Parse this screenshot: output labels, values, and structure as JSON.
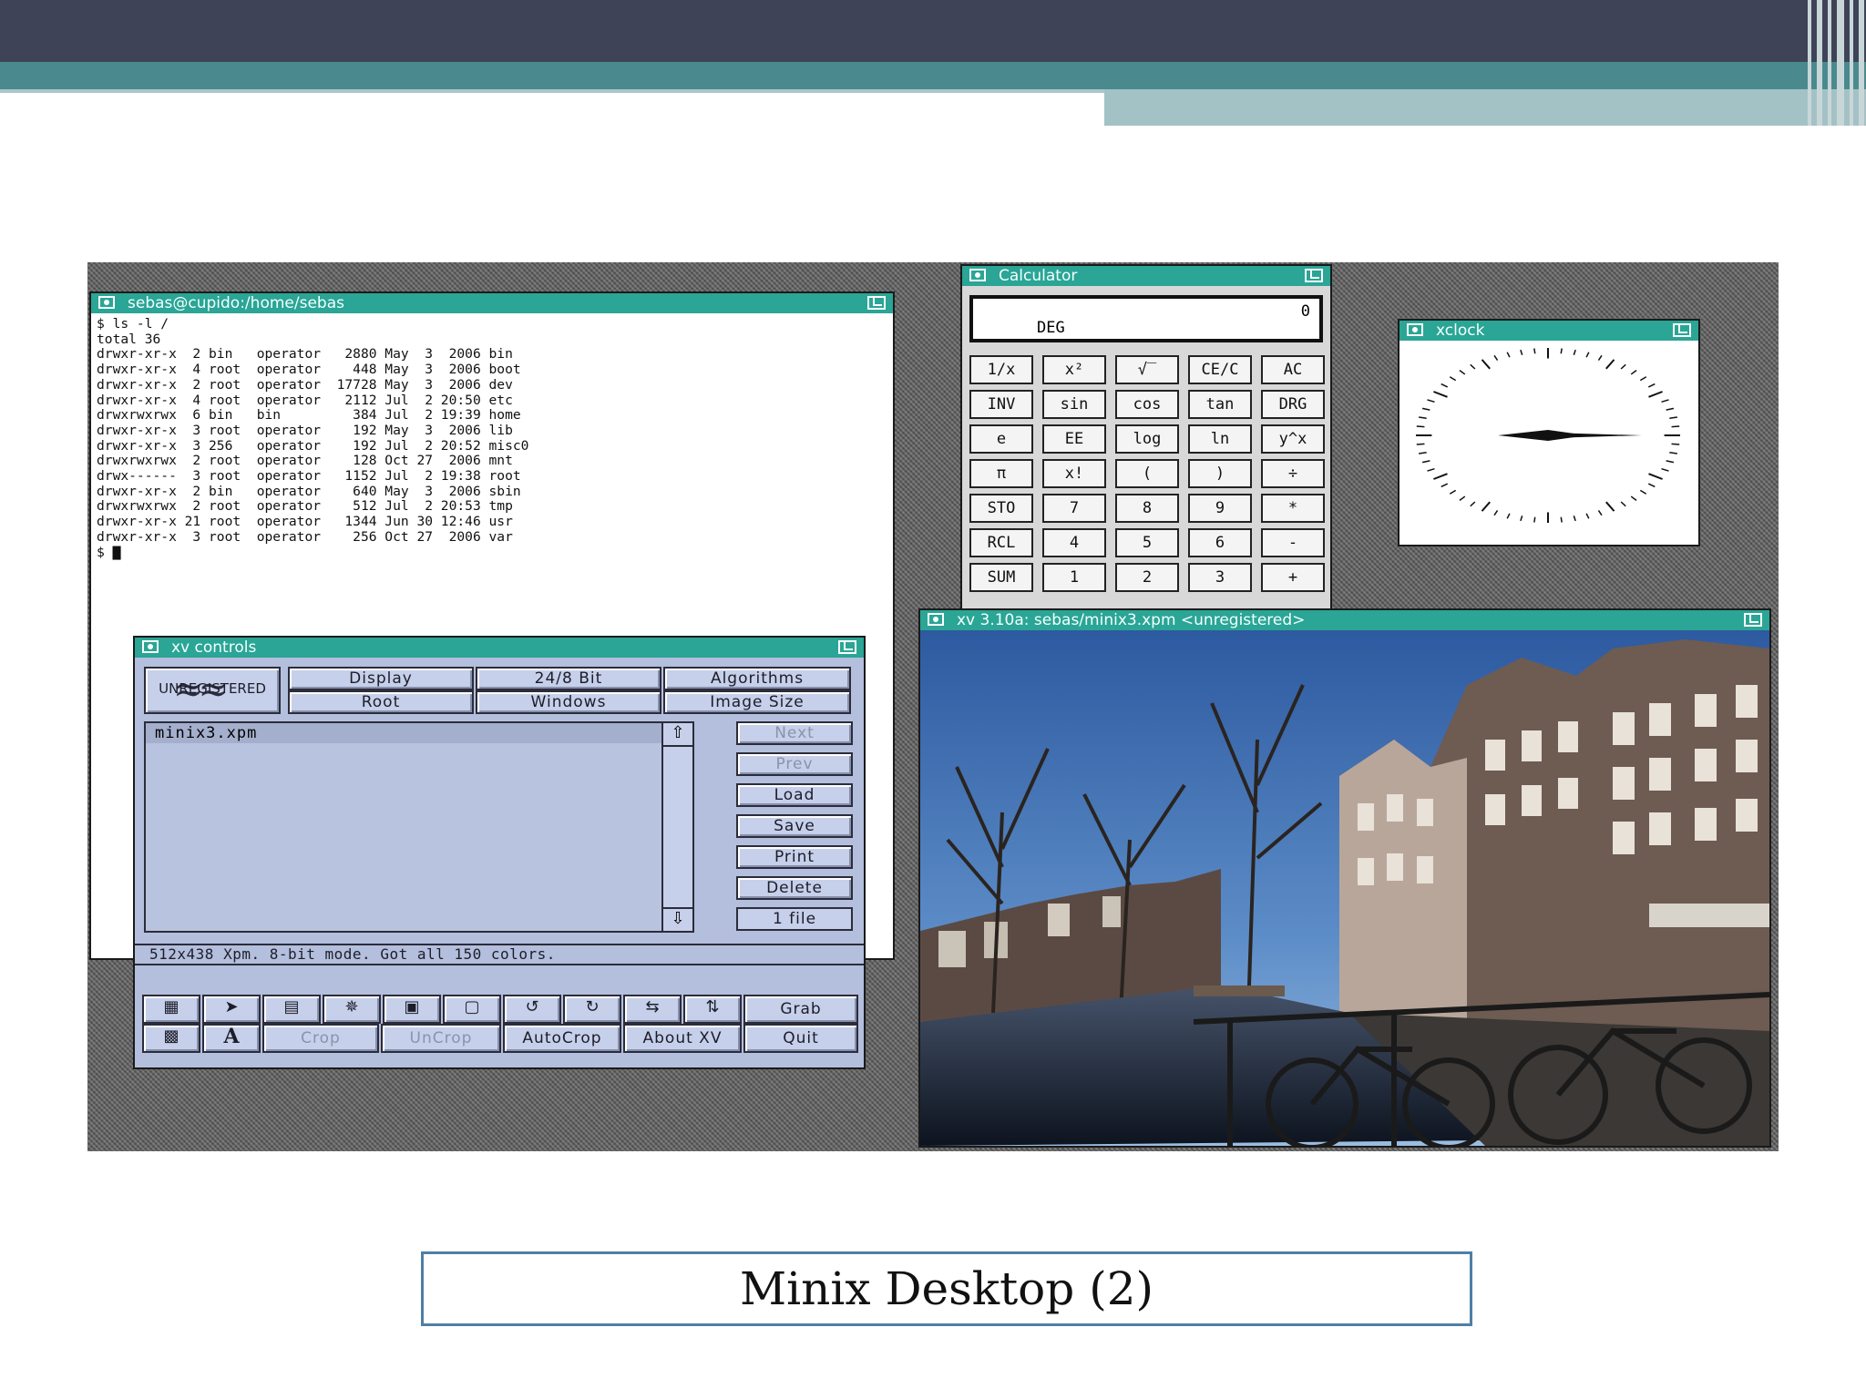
{
  "slide": {
    "caption": "Minix Desktop (2)"
  },
  "terminal": {
    "title": "sebas@cupido:/home/sebas",
    "lines": [
      "$ ls -l /",
      "total 36",
      "drwxr-xr-x  2 bin   operator   2880 May  3  2006 bin",
      "drwxr-xr-x  4 root  operator    448 May  3  2006 boot",
      "drwxr-xr-x  2 root  operator  17728 May  3  2006 dev",
      "drwxr-xr-x  4 root  operator   2112 Jul  2 20:50 etc",
      "drwxrwxrwx  6 bin   bin         384 Jul  2 19:39 home",
      "drwxr-xr-x  3 root  operator    192 May  3  2006 lib",
      "drwxr-xr-x  3 256   operator    192 Jul  2 20:52 misc0",
      "drwxrwxrwx  2 root  operator    128 Oct 27  2006 mnt",
      "drwx------  3 root  operator   1152 Jul  2 19:38 root",
      "drwxr-xr-x  2 bin   operator    640 May  3  2006 sbin",
      "drwxrwxrwx  2 root  operator    512 Jul  2 20:53 tmp",
      "drwxr-xr-x 21 root  operator   1344 Jun 30 12:46 usr",
      "drwxr-xr-x  3 root  operator    256 Oct 27  2006 var",
      "$ ▇"
    ]
  },
  "calculator": {
    "title": "Calculator",
    "display_value": "0",
    "display_mode": "DEG",
    "rows": [
      [
        "1/x",
        "x²",
        "√‾",
        "CE/C",
        "AC"
      ],
      [
        "INV",
        "sin",
        "cos",
        "tan",
        "DRG"
      ],
      [
        "e",
        "EE",
        "log",
        "ln",
        "y^x"
      ],
      [
        "π",
        "x!",
        "(",
        ")",
        "÷"
      ],
      [
        "STO",
        "7",
        "8",
        "9",
        "*"
      ],
      [
        "RCL",
        "4",
        "5",
        "6",
        "-"
      ],
      [
        "SUM",
        "1",
        "2",
        "3",
        "+"
      ]
    ]
  },
  "xclock": {
    "title": "xclock"
  },
  "xv_controls": {
    "title": "xv controls",
    "logo_text": "UNREGISTERED",
    "top_buttons": [
      "Display",
      "24/8 Bit",
      "Algorithms",
      "Root",
      "Windows",
      "Image Size"
    ],
    "files": [
      "minix3.xpm"
    ],
    "side_buttons": {
      "next": "Next",
      "prev": "Prev",
      "load": "Load",
      "save": "Save",
      "print": "Print",
      "delete": "Delete",
      "count": "1 file"
    },
    "status": "512x438 Xpm.  8-bit mode.  Got all 150 colors.",
    "bottom_buttons": {
      "grab": "Grab",
      "crop": "Crop",
      "uncrop": "UnCrop",
      "autocrop": "AutoCrop",
      "about": "About XV",
      "quit": "Quit",
      "text_tool": "A"
    }
  },
  "xv_image": {
    "title": "xv 3.10a: sebas/minix3.xpm <unregistered>"
  },
  "colors": {
    "titlebar": "#2aa596",
    "header_dark": "#3f4358",
    "header_teal": "#4a8a8f",
    "xv_panel": "#b3bfdc",
    "caption_border": "#4f7fa5"
  }
}
